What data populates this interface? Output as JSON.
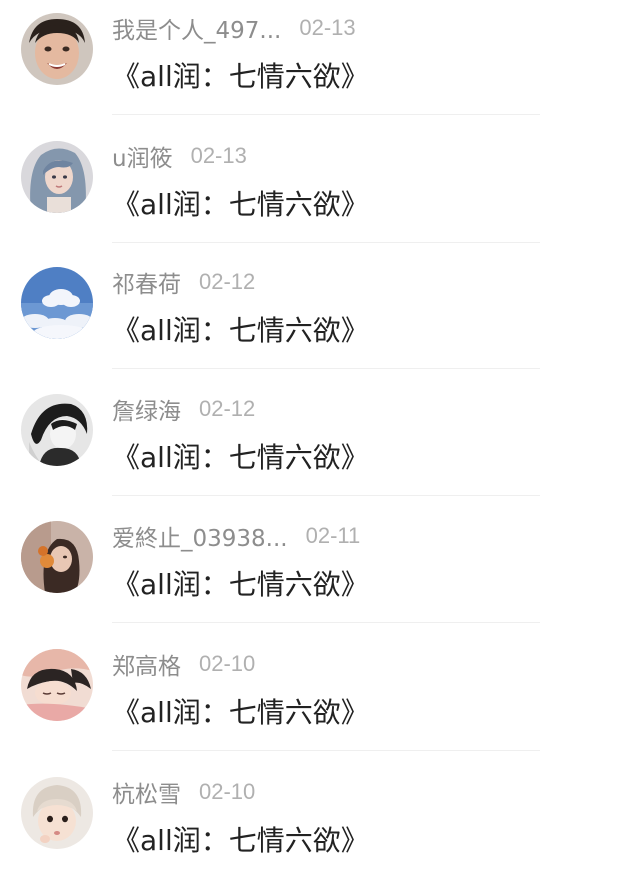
{
  "comments": [
    {
      "username": "我是个人_497...",
      "date": "02-13",
      "text": "《all润：七情六欲》",
      "avatar": "avatar-boy-face"
    },
    {
      "username": "u润筱",
      "date": "02-13",
      "text": "《all润：七情六欲》",
      "avatar": "avatar-blue-hair-girl"
    },
    {
      "username": "祁春荷",
      "date": "02-12",
      "text": "《all润：七情六欲》",
      "avatar": "avatar-clouds-sky"
    },
    {
      "username": "詹绿海",
      "date": "02-12",
      "text": "《all润：七情六欲》",
      "avatar": "avatar-monochrome-figure"
    },
    {
      "username": "爱終止_03938...",
      "date": "02-11",
      "text": "《all润：七情六欲》",
      "avatar": "avatar-girl-orange"
    },
    {
      "username": "郑高格",
      "date": "02-10",
      "text": "《all润：七情六欲》",
      "avatar": "avatar-sleeping-anime"
    },
    {
      "username": "杭松雪",
      "date": "02-10",
      "text": "《all润：七情六欲》",
      "avatar": "avatar-baby-hat"
    }
  ]
}
